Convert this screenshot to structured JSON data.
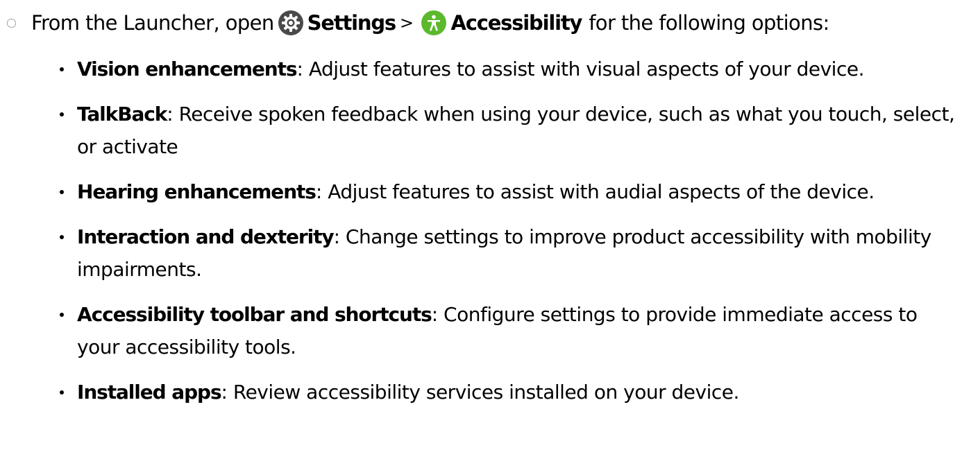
{
  "intro": {
    "prefix": "From the Launcher, open",
    "settings_label": "Settings",
    "separator": ">",
    "accessibility_label": "Accessibility",
    "suffix": "for the following options:"
  },
  "icons": {
    "settings": "gear-icon",
    "accessibility": "accessibility-person-icon",
    "settings_color": "#4a4a4a",
    "accessibility_color": "#5cb82c"
  },
  "options": [
    {
      "title": "Vision enhancements",
      "separator": ":",
      "description": "Adjust features to assist with visual aspects of your device."
    },
    {
      "title": "TalkBack",
      "separator": ":",
      "description": "Receive spoken feedback when using your device, such as what you touch, select, or activate"
    },
    {
      "title": "Hearing enhancements",
      "separator": ":",
      "description": "Adjust features to assist with audial aspects of the device."
    },
    {
      "title": "Interaction and dexterity",
      "separator": ":",
      "description": "Change settings to improve product accessibility with mobility impairments."
    },
    {
      "title": "Accessibility toolbar and shortcuts",
      "separator": ":",
      "description": "Configure settings to provide immediate access to your accessibility tools."
    },
    {
      "title": "Installed apps",
      "separator": ":",
      "description": "Review accessibility services installed on your device."
    }
  ]
}
